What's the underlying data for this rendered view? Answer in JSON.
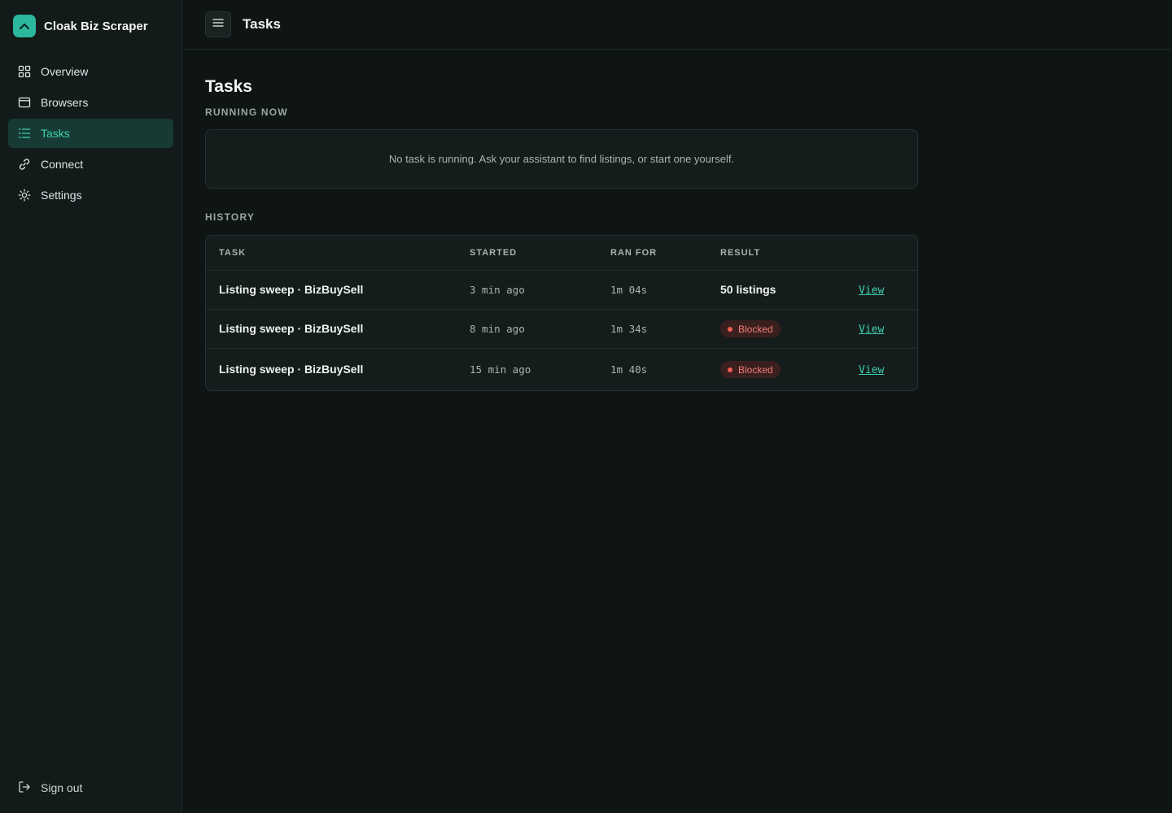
{
  "app": {
    "name": "Cloak Biz Scraper",
    "accent": "#2bb89c"
  },
  "sidebar": {
    "items": [
      {
        "label": "Overview",
        "icon": "grid-icon"
      },
      {
        "label": "Browsers",
        "icon": "browser-window-icon"
      },
      {
        "label": "Tasks",
        "icon": "list-icon",
        "active": true
      },
      {
        "label": "Connect",
        "icon": "link-icon"
      },
      {
        "label": "Settings",
        "icon": "gear-icon"
      }
    ],
    "signout_label": "Sign out"
  },
  "topbar": {
    "title": "Tasks"
  },
  "page": {
    "title": "Tasks",
    "running_label": "RUNNING NOW",
    "running_empty": "No task is running. Ask your assistant to find listings, or start one yourself.",
    "history_label": "HISTORY"
  },
  "history": {
    "columns": [
      "TASK",
      "STARTED",
      "RAN FOR",
      "RESULT"
    ],
    "rows": [
      {
        "task": "Listing sweep · BizBuySell",
        "started": "3 min ago",
        "ran_for": "1m 04s",
        "result": "50 listings",
        "status": "ok",
        "action": "View"
      },
      {
        "task": "Listing sweep · BizBuySell",
        "started": "8 min ago",
        "ran_for": "1m 34s",
        "result": "Blocked",
        "status": "blocked",
        "action": "View"
      },
      {
        "task": "Listing sweep · BizBuySell",
        "started": "15 min ago",
        "ran_for": "1m 40s",
        "result": "Blocked",
        "status": "blocked",
        "action": "View"
      }
    ]
  }
}
